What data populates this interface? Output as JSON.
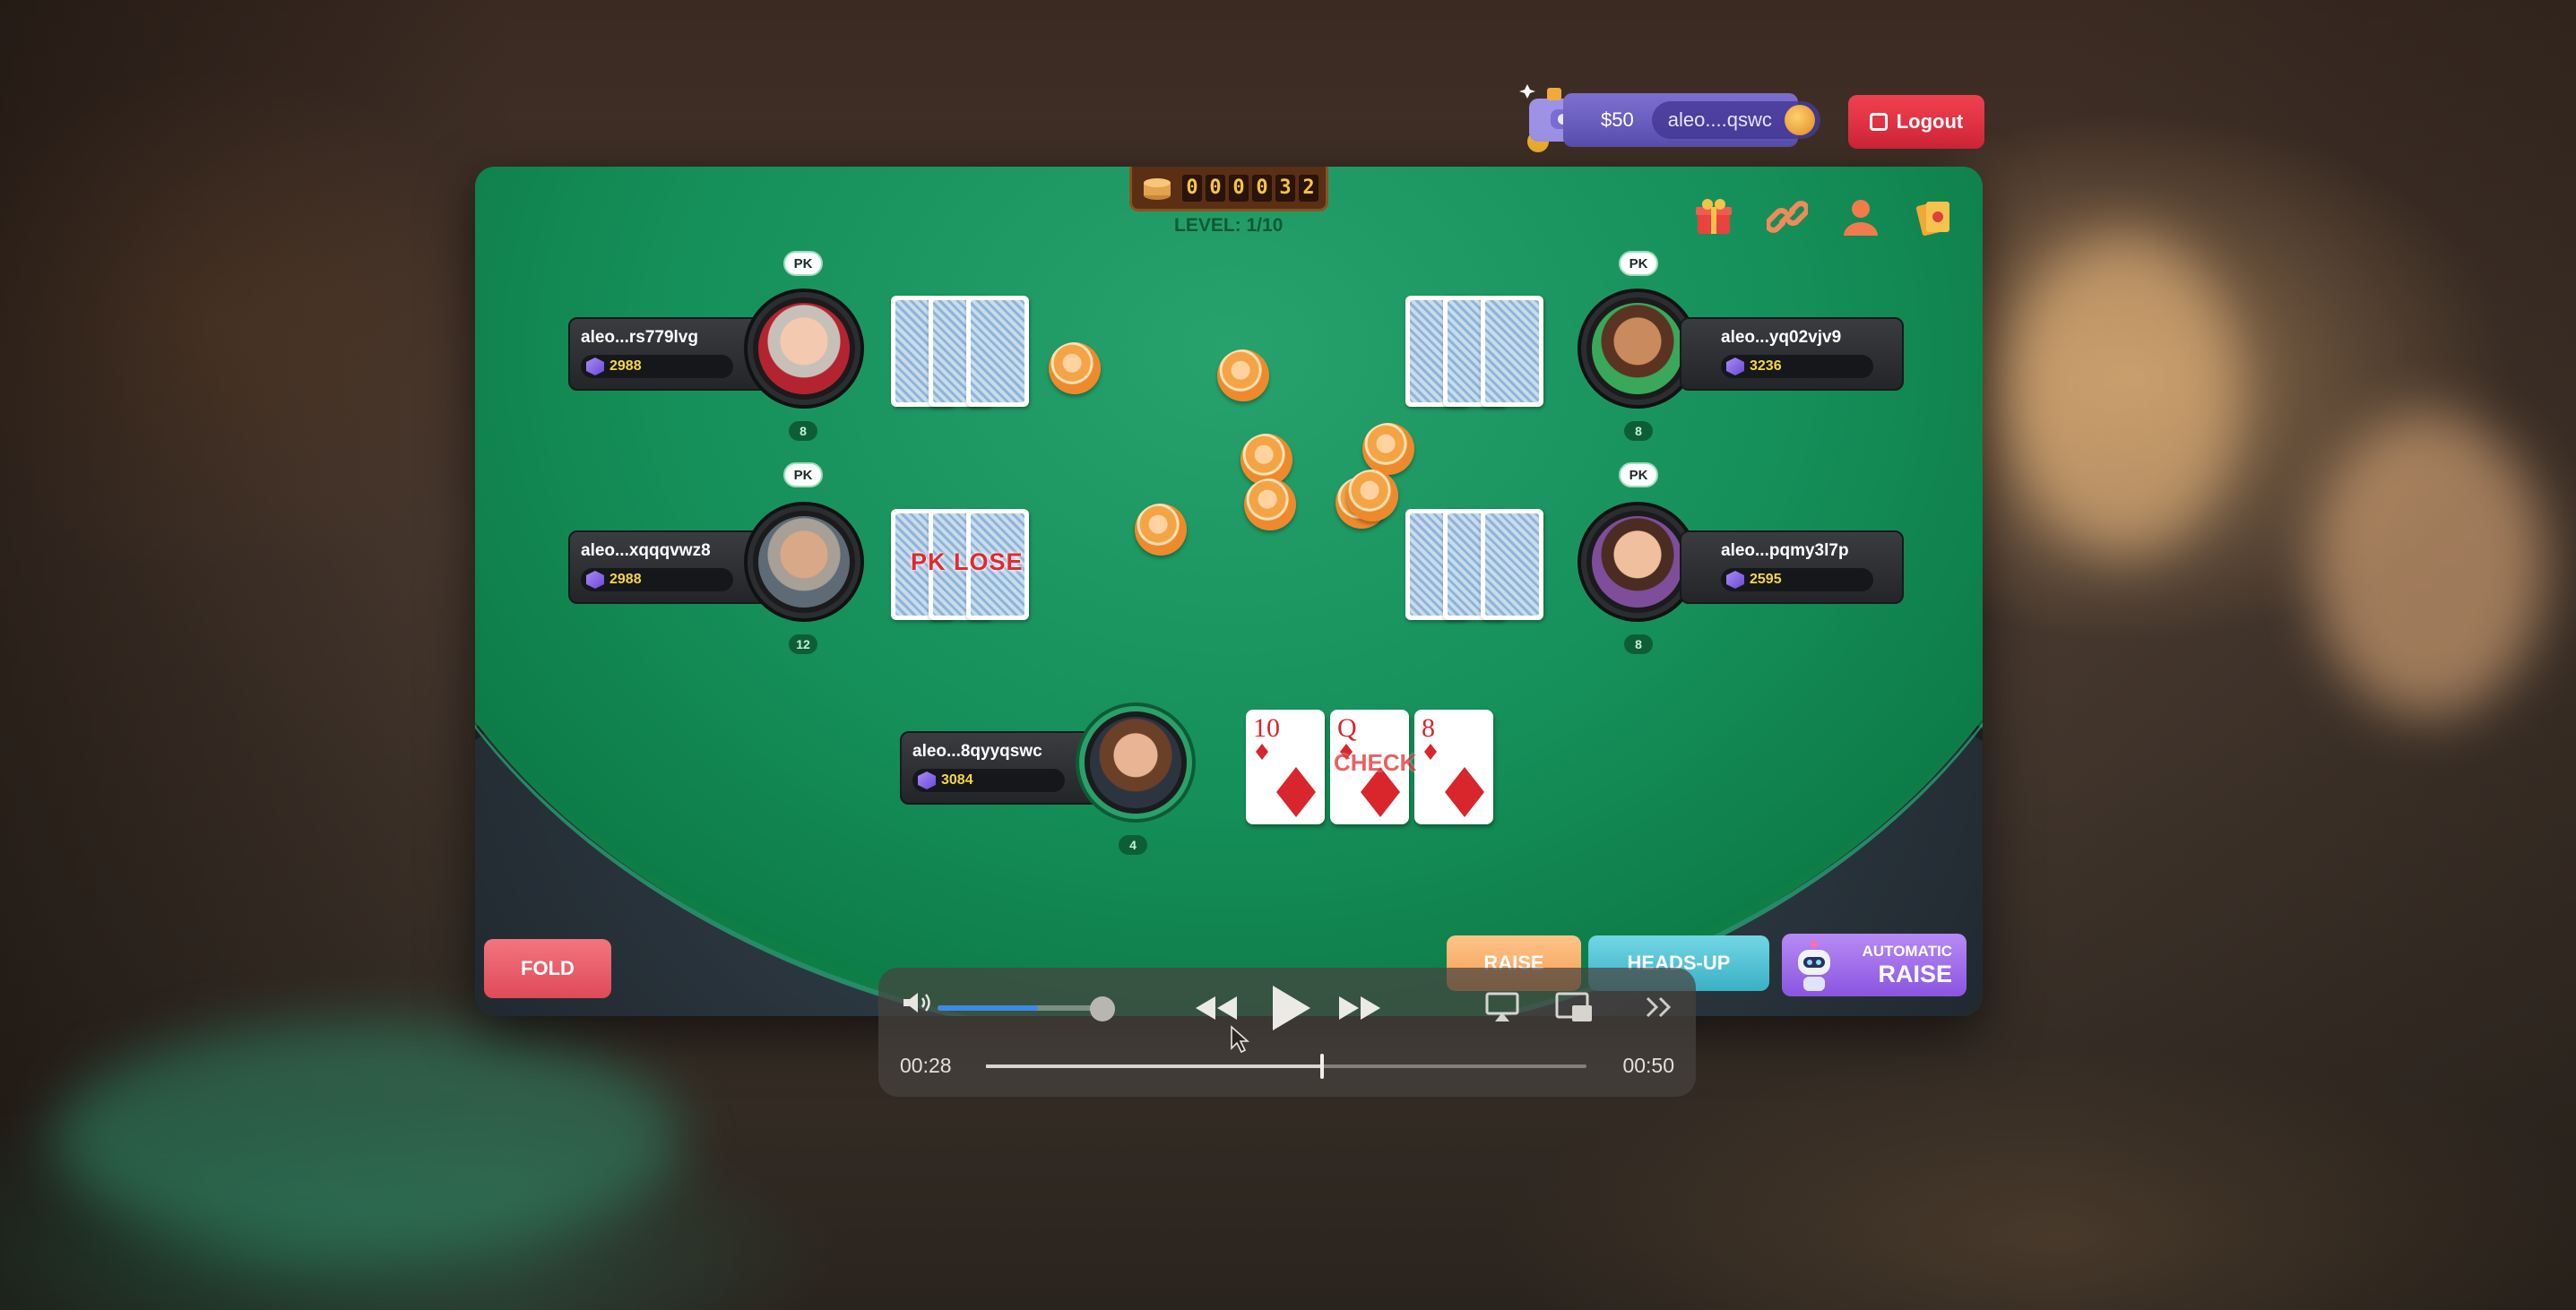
{
  "header": {
    "wallet_amount": "$50",
    "wallet_user": "aleo....qswc",
    "logout_label": "Logout"
  },
  "table": {
    "pot_digits": [
      "0",
      "0",
      "0",
      "0",
      "3",
      "2"
    ],
    "level": "LEVEL: 1/10",
    "top_icons": [
      "gift-icon",
      "link-icon",
      "profile-icon",
      "cards-icon"
    ]
  },
  "players": [
    {
      "name": "aleo...rs779lvg",
      "balance": "2988",
      "badge": "PK",
      "count": "8"
    },
    {
      "name": "aleo...xqqqvwz8",
      "balance": "2988",
      "badge": "PK",
      "count": "12",
      "status": "PK LOSE"
    },
    {
      "name": "aleo...yq02vjv9",
      "balance": "3236",
      "badge": "PK",
      "count": "8"
    },
    {
      "name": "aleo...pqmy3l7p",
      "balance": "2595",
      "badge": "PK",
      "count": "8"
    },
    {
      "name": "aleo...8qyyqswc",
      "balance": "3084",
      "count": "4"
    }
  ],
  "my_cards": [
    {
      "rank": "10",
      "suit": "diamonds"
    },
    {
      "rank": "Q",
      "suit": "diamonds"
    },
    {
      "rank": "8",
      "suit": "diamonds"
    }
  ],
  "my_action": "CHECK",
  "actions": {
    "fold": "FOLD",
    "raise": "RAISE",
    "heads_up": "HEADS-UP",
    "auto_line1": "AUTOMATIC",
    "auto_line2": "RAISE"
  },
  "video": {
    "current_time": "00:28",
    "duration": "00:50",
    "progress": 0.56,
    "volume": 0.62
  },
  "colors": {
    "felt": "#16905a",
    "logout": "#e03242",
    "wallet": "#6a5fc4",
    "fold": "#e55c68",
    "raise": "#f7a963",
    "heads_up": "#52c3d4",
    "automatic": "#a070ea"
  }
}
